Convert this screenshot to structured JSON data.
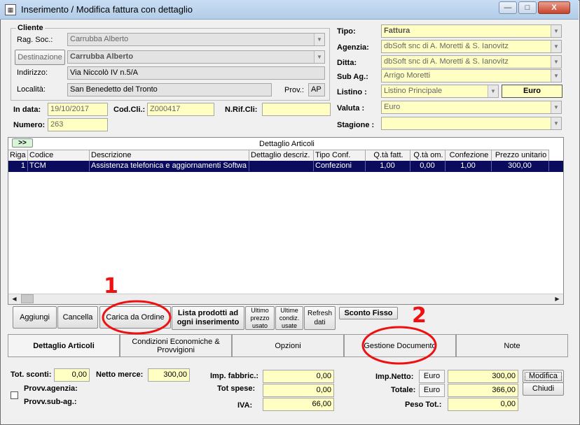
{
  "window": {
    "title": "Inserimento / Modifica fattura con dettaglio",
    "icon": "invoice-app-icon",
    "controls": {
      "minimize": "—",
      "maximize": "□",
      "close": "X"
    }
  },
  "cliente": {
    "group_label": "Cliente",
    "rag_soc_label": "Rag. Soc.:",
    "rag_soc_value": "Carrubba Alberto",
    "destinazione_button": "Destinazione",
    "destinazione_value": "Carrubba Alberto",
    "indirizzo_label": "Indirizzo:",
    "indirizzo_value": "Via Niccolò IV n.5/A",
    "localita_label": "Località:",
    "localita_value": "San Benedetto del Tronto",
    "prov_label": "Prov.:",
    "prov_value": "AP"
  },
  "right": {
    "tipo_label": "Tipo:",
    "tipo_value": "Fattura",
    "agenzia_label": "Agenzia:",
    "agenzia_value": "dbSoft snc di A. Moretti & S. Ianovitz",
    "ditta_label": "Ditta:",
    "ditta_value": "dbSoft snc di A. Moretti & S. Ianovitz",
    "subag_label": "Sub Ag.:",
    "subag_value": "Arrigo Moretti",
    "listino_label": "Listino :",
    "listino_value": "Listino Principale",
    "listino_currency": "Euro",
    "valuta_label": "Valuta :",
    "valuta_value": "Euro",
    "stagione_label": "Stagione :",
    "stagione_value": ""
  },
  "doc": {
    "indata_label": "In data:",
    "indata_value": "19/10/2017",
    "codcli_label": "Cod.Cli.:",
    "codcli_value": "Z000417",
    "nrif_label": "N.Rif.Cli:",
    "nrif_value": "",
    "numero_label": "Numero:",
    "numero_value": "263"
  },
  "grid": {
    "expand_button": ">>",
    "title": "Dettaglio Articoli",
    "columns": [
      "Riga",
      "Codice",
      "Descrizione",
      "Dettaglio descriz.",
      "Tipo Conf.",
      "Q.tà fatt.",
      "Q.tà om.",
      "Confezione",
      "Prezzo unitario"
    ],
    "rows": [
      [
        "1",
        "TCM",
        "Assistenza telefonica e aggiornamenti Softwa",
        "",
        "Confezioni",
        "1,00",
        "0,00",
        "1,00",
        "300,00"
      ]
    ]
  },
  "actions": {
    "aggiungi": "Aggiungi",
    "cancella": "Cancella",
    "carica_ordine": "Carica da Ordine",
    "lista_prodotti": "Lista prodotti ad ogni inserimento",
    "ultimo_prezzo": "Ultimo prezzo usato",
    "ultime_condiz": "Ultime condiz. usate",
    "refresh": "Refresh dati",
    "sconto_fisso": "Sconto Fisso"
  },
  "annotations": {
    "one": "1",
    "two": "2"
  },
  "tabs": [
    "Dettaglio Articoli",
    "Condizioni Economiche & Provvigioni",
    "Opzioni",
    "Gestione Documento",
    "Note"
  ],
  "totals": {
    "tot_sconti_label": "Tot. sconti:",
    "tot_sconti_value": "0,00",
    "netto_merce_label": "Netto merce:",
    "netto_merce_value": "300,00",
    "provv_agenzia_label": "Provv.agenzia:",
    "provv_subag_label": "Provv.sub-ag.:",
    "imp_fabbric_label": "Imp. fabbric.:",
    "imp_fabbric_value": "0,00",
    "tot_spese_label": "Tot spese:",
    "tot_spese_value": "0,00",
    "iva_label": "IVA:",
    "iva_value": "66,00",
    "imp_netto_label": "Imp.Netto:",
    "imp_netto_currency": "Euro",
    "imp_netto_value": "300,00",
    "totale_label": "Totale:",
    "totale_currency": "Euro",
    "totale_value": "366,00",
    "peso_label": "Peso Tot.:",
    "peso_value": "0,00",
    "modifica_button": "Modifica",
    "chiudi_button": "Chiudi"
  },
  "colors": {
    "selected_row": "#0b0b5e",
    "field_yellow": "#ffffc4",
    "annotation_red": "#ee1111"
  }
}
